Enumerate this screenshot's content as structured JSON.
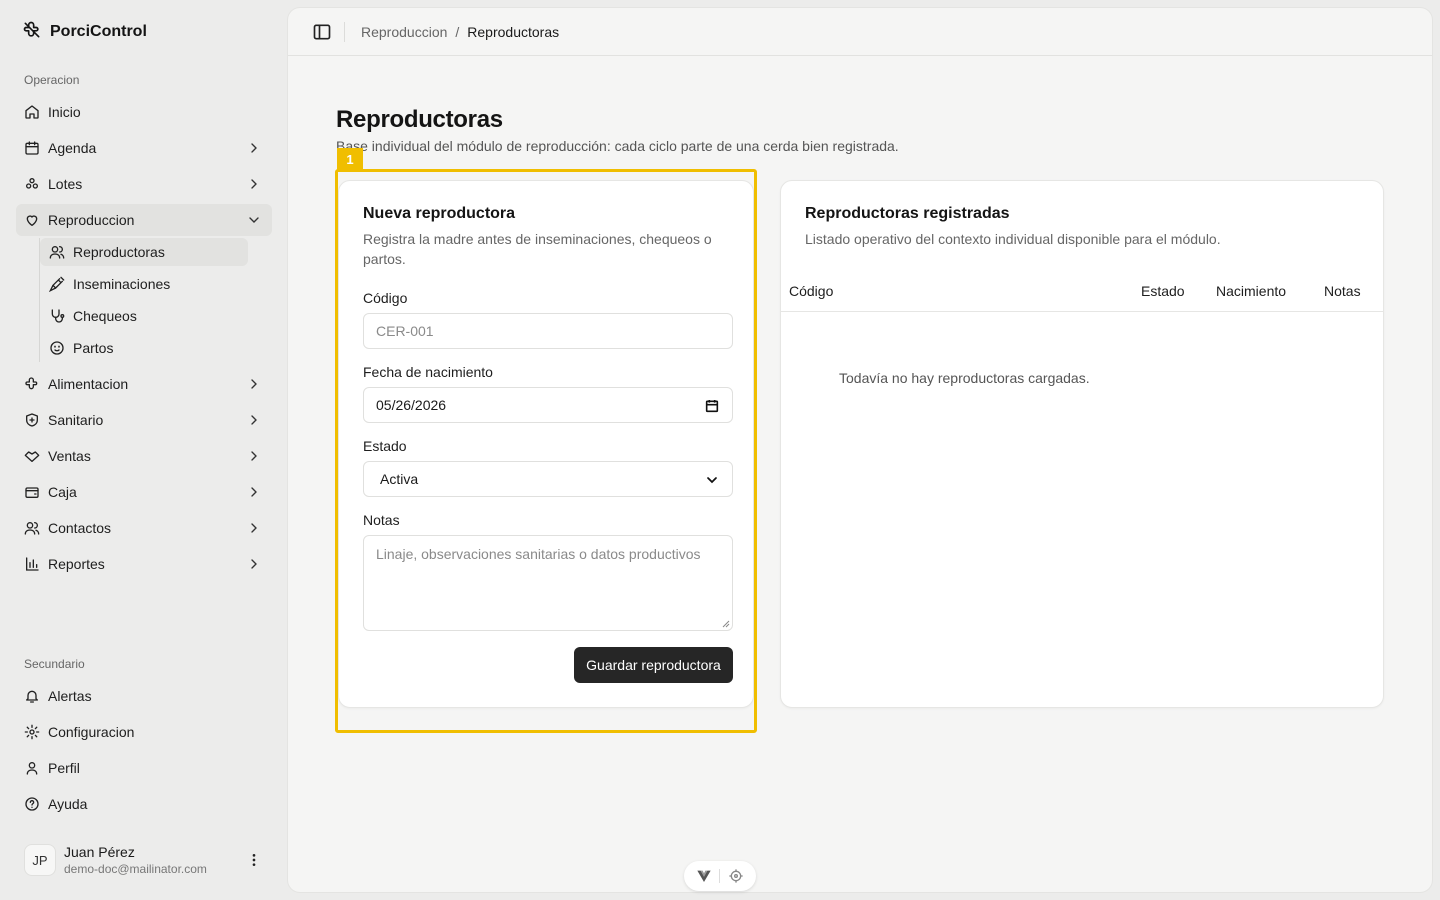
{
  "app": {
    "name": "PorciControl"
  },
  "sidebar": {
    "group_operacion": "Operacion",
    "items": [
      {
        "label": "Inicio",
        "icon": "home-icon"
      },
      {
        "label": "Agenda",
        "icon": "calendar-icon"
      },
      {
        "label": "Lotes",
        "icon": "lots-icon"
      },
      {
        "label": "Reproduccion",
        "icon": "heart-icon"
      },
      {
        "label": "Alimentacion",
        "icon": "feed-icon"
      },
      {
        "label": "Sanitario",
        "icon": "shield-icon"
      },
      {
        "label": "Ventas",
        "icon": "handshake-icon"
      },
      {
        "label": "Caja",
        "icon": "wallet-icon"
      },
      {
        "label": "Contactos",
        "icon": "users-icon"
      },
      {
        "label": "Reportes",
        "icon": "chart-icon"
      }
    ],
    "subitems": [
      {
        "label": "Reproductoras",
        "icon": "users-icon"
      },
      {
        "label": "Inseminaciones",
        "icon": "syringe-icon"
      },
      {
        "label": "Chequeos",
        "icon": "stethoscope-icon"
      },
      {
        "label": "Partos",
        "icon": "baby-icon"
      }
    ],
    "group_secundario": "Secundario",
    "secondary": [
      {
        "label": "Alertas",
        "icon": "bell-icon"
      },
      {
        "label": "Configuracion",
        "icon": "gear-icon"
      },
      {
        "label": "Perfil",
        "icon": "user-icon"
      },
      {
        "label": "Ayuda",
        "icon": "help-icon"
      }
    ],
    "user": {
      "initials": "JP",
      "name": "Juan Pérez",
      "email": "demo-doc@mailinator.com"
    }
  },
  "breadcrumb": {
    "parent": "Reproduccion",
    "separator": "/",
    "current": "Reproductoras"
  },
  "page": {
    "title": "Reproductoras",
    "subtitle": "Base individual del módulo de reproducción: cada ciclo parte de una cerda bien registrada."
  },
  "form": {
    "title": "Nueva reproductora",
    "description_line1": "Registra la madre antes de inseminaciones, chequeos o",
    "description_line2": "partos.",
    "codigo_label": "Código",
    "codigo_placeholder": "CER-001",
    "fecha_label": "Fecha de nacimiento",
    "fecha_value": "05/26/2026",
    "estado_label": "Estado",
    "estado_value": "Activa",
    "notas_label": "Notas",
    "notas_placeholder": "Linaje, observaciones sanitarias o datos productivos",
    "save_label": "Guardar reproductora"
  },
  "list": {
    "title": "Reproductoras registradas",
    "description": "Listado operativo del contexto individual disponible para el módulo.",
    "columns": [
      "Código",
      "Estado",
      "Nacimiento",
      "Notas"
    ],
    "empty": "Todavía no hay reproductoras cargadas."
  },
  "highlight": {
    "tag": "1",
    "color": "#f0be00"
  },
  "colors": {
    "primary_button": "#262626",
    "sidebar_bg": "#ececeb",
    "main_bg": "#f5f5f4"
  }
}
